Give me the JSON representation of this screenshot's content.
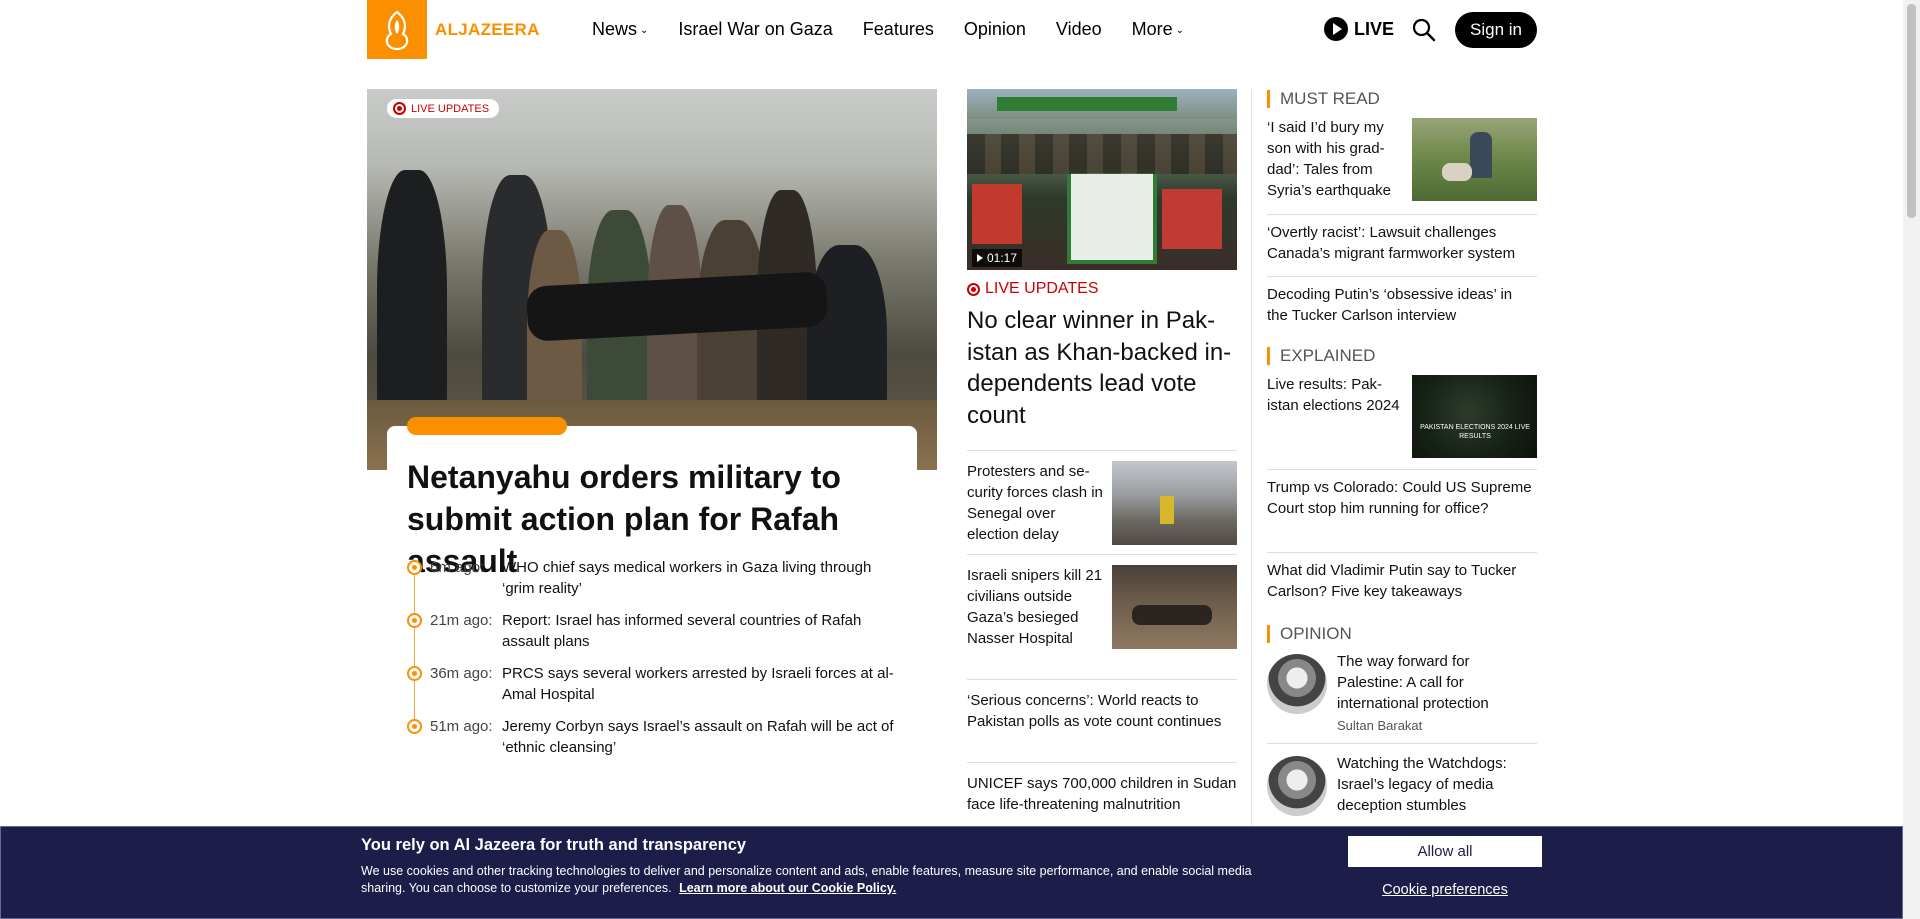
{
  "header": {
    "logo_text": "ALJAZEERA",
    "nav": [
      {
        "label": "News",
        "has_dropdown": true
      },
      {
        "label": "Israel War on Gaza",
        "has_dropdown": false
      },
      {
        "label": "Features",
        "has_dropdown": false
      },
      {
        "label": "Opinion",
        "has_dropdown": false
      },
      {
        "label": "Video",
        "has_dropdown": false
      },
      {
        "label": "More",
        "has_dropdown": true
      }
    ],
    "live_label": "LIVE",
    "signin_label": "Sign in"
  },
  "hero": {
    "badge": "LIVE UPDATES",
    "title": "Netanyahu orders military to sub­mit action plan for Rafah assault",
    "updates": [
      {
        "time": "6m ago:",
        "text": "WHO chief says medical workers in Gaza living through ‘grim reality’"
      },
      {
        "time": "21m ago:",
        "text": "Report: Israel has informed several countries of Rafah assault plans"
      },
      {
        "time": "36m ago:",
        "text": "PRCS says several workers arrested by Israeli forces at al-Amal Hospital"
      },
      {
        "time": "51m ago:",
        "text": "Jeremy Corbyn says Israel’s assault on Rafah will be act of ‘ethnic cleansing’"
      }
    ]
  },
  "center": {
    "video_duration": "01:17",
    "live_label": "LIVE UPDATES",
    "title": "No clear winner in Pak­istan as Khan-backed in­dependents lead vote count",
    "items": [
      {
        "text": "Protesters and se­curity forces clash in Senegal over election delay"
      },
      {
        "text": "Israeli snipers kill 21 civilians out­side Gaza’s be­sieged Nasser Hospital"
      },
      {
        "text": "‘Serious concerns’: World reacts to Pakistan polls as vote count contin­ues"
      },
      {
        "text": "UNICEF says 700,000 children in Su­dan face life-threatening malnutrition"
      }
    ]
  },
  "right": {
    "must_read_label": "MUST READ",
    "must_read": [
      {
        "text": "‘I said I’d bury my son with his grad­dad’: Tales from Syria’s earthquake"
      },
      {
        "text": "‘Overtly racist’: Lawsuit challenges Canada’s migrant farmworker system"
      },
      {
        "text": "Decoding Putin’s ‘obsessive ideas’ in the Tucker Carlson interview"
      }
    ],
    "explained_label": "EXPLAINED",
    "explained": [
      {
        "text": "Live results: Pak­istan elections 2024"
      },
      {
        "text": "Trump vs Colorado: Could US Supreme Court stop him running for office?"
      },
      {
        "text": "What did Vladimir Putin say to Tucker Carlson? Five key takeaways"
      }
    ],
    "explained_thumb_caption": "PAKISTAN ELECTIONS 2024 LIVE RESULTS",
    "opinion_label": "OPINION",
    "opinion": [
      {
        "title": "The way forward for Palestine: A call for international protection",
        "author": "Sultan Barakat"
      },
      {
        "title": "Watching the Watchdogs: Israel’s legacy of media deception stumbles",
        "author": ""
      }
    ]
  },
  "cookie": {
    "title": "You rely on Al Jazeera for truth and transparency",
    "text": "We use cookies and other tracking technologies to deliver and personalize content and ads, enable features, measure site performance, and enable social media sharing. You can choose to customize your preferences.",
    "link": "Learn more about our Cookie Policy.",
    "allow_label": "Allow all",
    "prefs_label": "Cookie preferences"
  },
  "colors": {
    "brand": "#fa9000",
    "live": "#cc0000",
    "cookie_bg": "#1c1d48"
  }
}
